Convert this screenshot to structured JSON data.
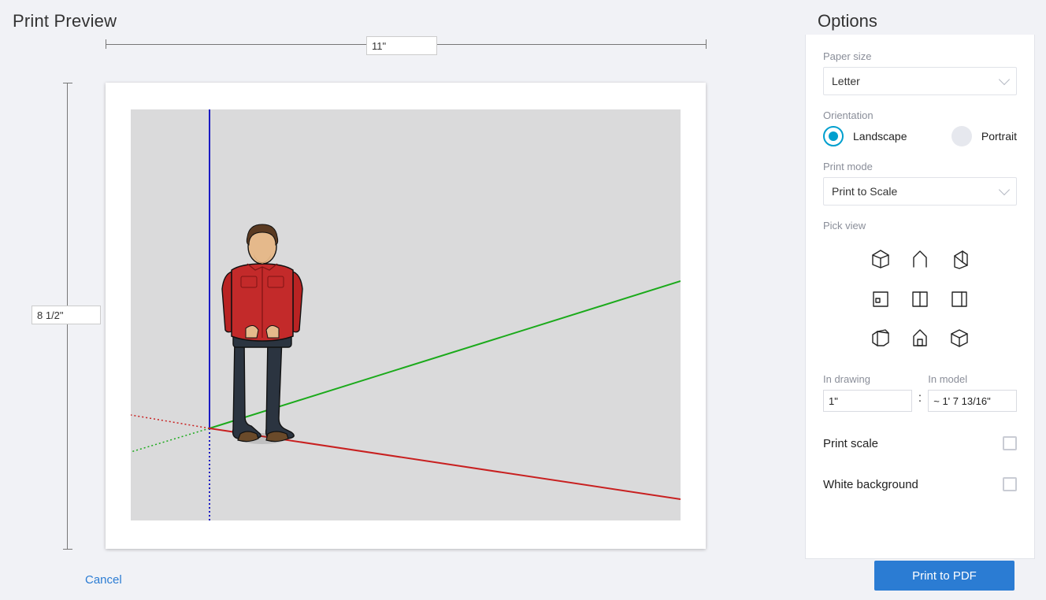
{
  "title": "Print Preview",
  "page_width": "11\"",
  "page_height": "8 1/2\"",
  "cancel_label": "Cancel",
  "options": {
    "title": "Options",
    "paper_size": {
      "label": "Paper size",
      "value": "Letter"
    },
    "orientation": {
      "label": "Orientation",
      "landscape": "Landscape",
      "portrait": "Portrait",
      "selected": "landscape"
    },
    "print_mode": {
      "label": "Print mode",
      "value": "Print to Scale"
    },
    "pick_view": {
      "label": "Pick view"
    },
    "in_drawing": {
      "label": "In drawing",
      "value": "1\""
    },
    "in_model": {
      "label": "In model",
      "value": "~ 1' 7 13/16\""
    },
    "print_scale": {
      "label": "Print scale",
      "checked": false
    },
    "white_background": {
      "label": "White background",
      "checked": false
    }
  },
  "print_button": "Print to PDF"
}
